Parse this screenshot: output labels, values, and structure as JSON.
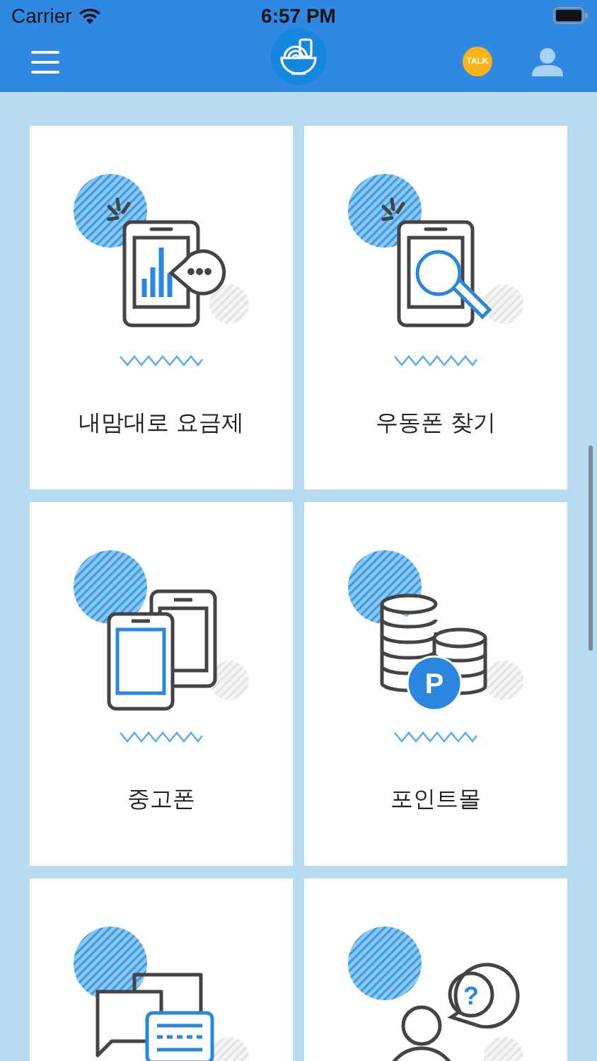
{
  "status_bar": {
    "carrier": "Carrier",
    "time": "6:57 PM"
  },
  "header": {
    "talk_badge": "TALK"
  },
  "tiles": [
    {
      "kind": "chart-phone",
      "label": "내맘대로 요금제"
    },
    {
      "kind": "search-phone",
      "label": "우동폰 찾기"
    },
    {
      "kind": "two-phones",
      "label": "중고폰"
    },
    {
      "kind": "coins",
      "label": "포인트몰",
      "badge": "P"
    },
    {
      "kind": "chat"
    },
    {
      "kind": "person-question",
      "badge": "?"
    }
  ]
}
